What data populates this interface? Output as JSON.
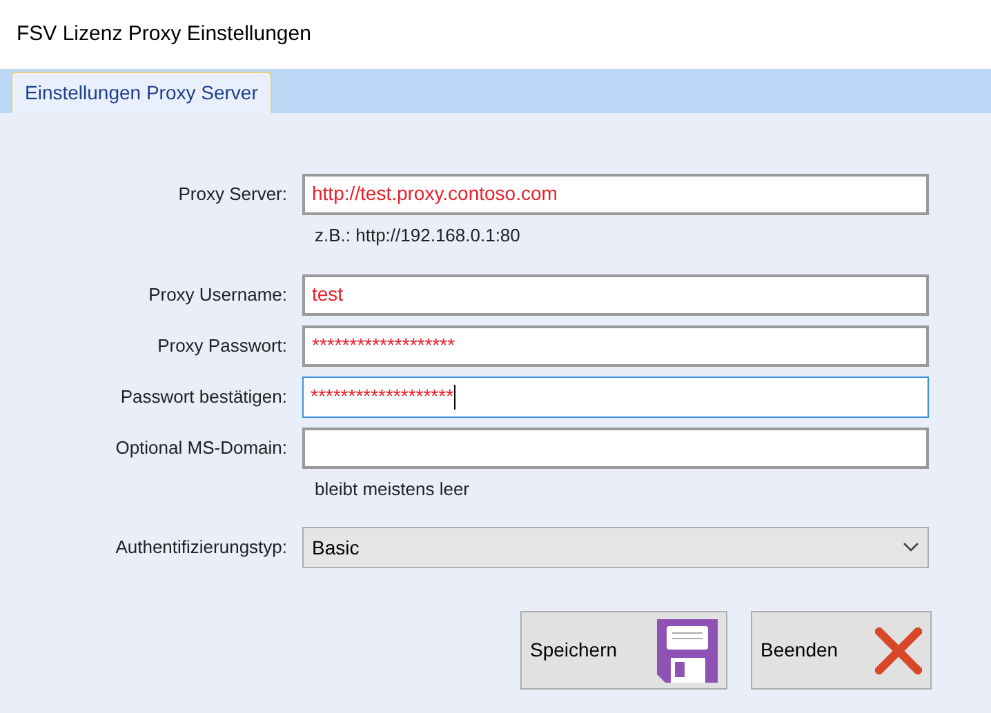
{
  "window": {
    "title": "FSV Lizenz Proxy Einstellungen"
  },
  "tabs": [
    {
      "label": "Einstellungen Proxy Server",
      "selected": true
    }
  ],
  "form": [
    {
      "kind": "field",
      "label": "Proxy Server:",
      "value": "http://test.proxy.contoso.com",
      "focused": false
    },
    {
      "kind": "hint",
      "text": "z.B.: http://192.168.0.1:80"
    },
    {
      "kind": "field",
      "label": "Proxy Username:",
      "value": "test",
      "focused": false
    },
    {
      "kind": "field",
      "label": "Proxy Passwort:",
      "value": "*******************",
      "focused": false
    },
    {
      "kind": "field",
      "label": "Passwort bestätigen:",
      "value": "*******************",
      "focused": true
    },
    {
      "kind": "field",
      "label": "Optional MS-Domain:",
      "focused": false
    },
    {
      "kind": "hint",
      "text": "bleibt meistens leer"
    },
    {
      "kind": "select",
      "label": "Authentifizierungstyp:",
      "value": "Basic"
    }
  ],
  "buttons": [
    {
      "label": "Speichern",
      "kind": "save"
    },
    {
      "label": "Beenden",
      "kind": "close"
    }
  ]
}
